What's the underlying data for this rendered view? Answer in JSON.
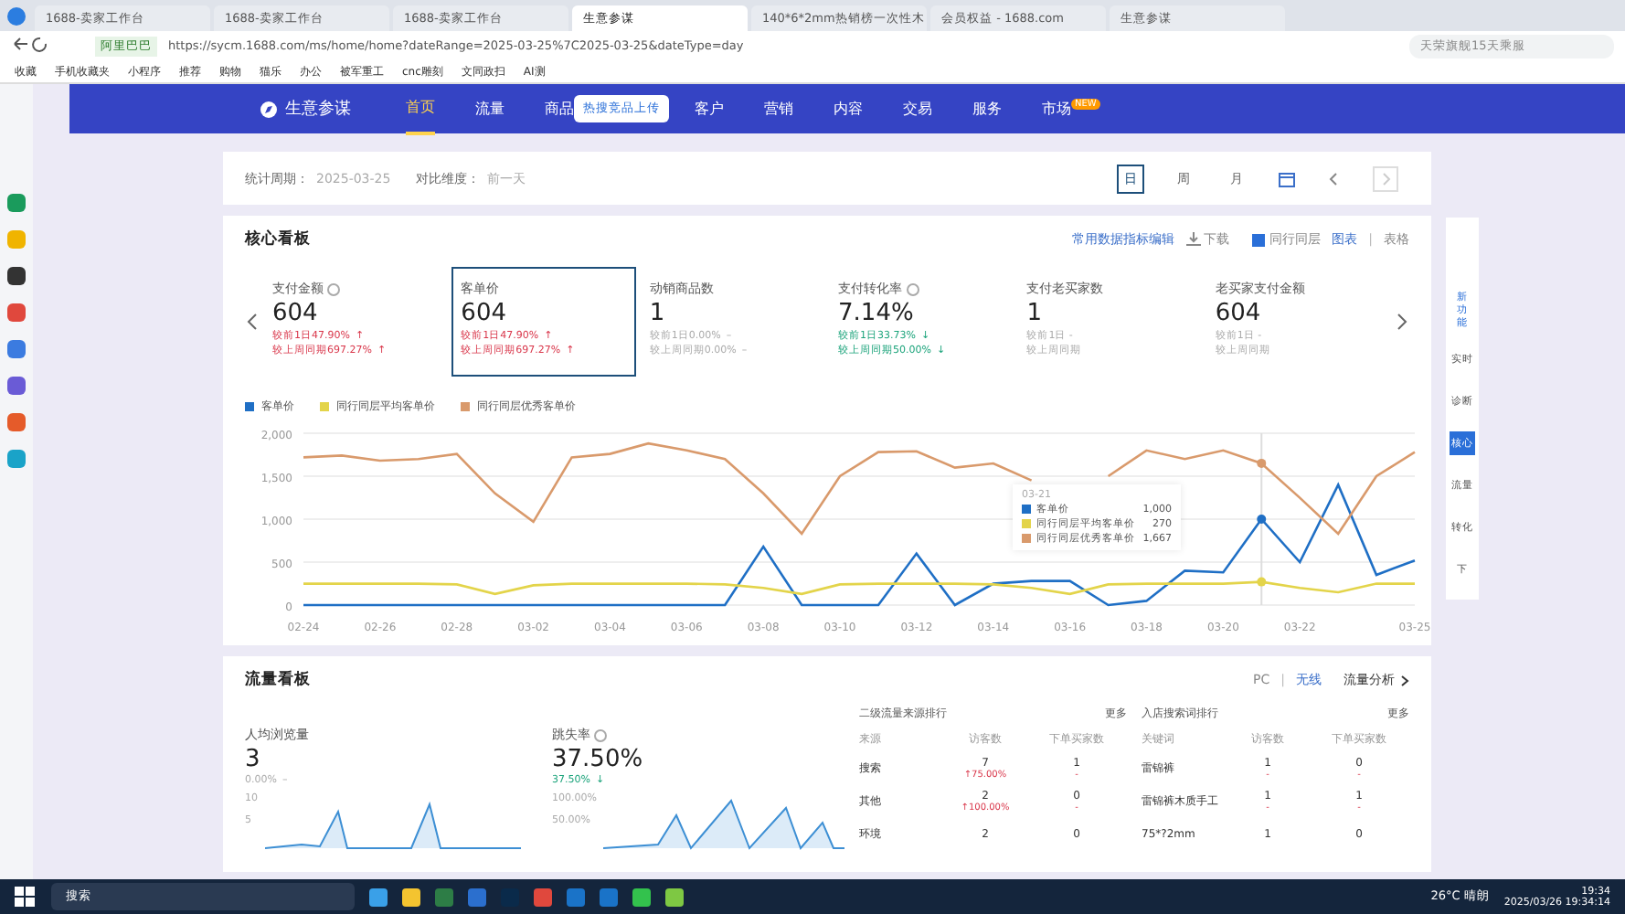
{
  "browser": {
    "tabs": [
      {
        "title": "1688-卖家工作台",
        "selected": false
      },
      {
        "title": "1688-卖家工作台",
        "selected": false
      },
      {
        "title": "1688-卖家工作台",
        "selected": false
      },
      {
        "title": "生意参谋",
        "selected": true
      },
      {
        "title": "140*6*2mm热销榜一次性木",
        "selected": false
      },
      {
        "title": "会员权益 - 1688.com",
        "selected": false
      },
      {
        "title": "生意参谋",
        "selected": false
      }
    ],
    "site_label": "阿里巴巴",
    "url": "https://sycm.1688.com/ms/home/home?dateRange=2025-03-25%7C2025-03-25&dateType=day",
    "search": "天荣旗舰15天乘服",
    "bookmarks": [
      "收藏",
      "手机收藏夹",
      "小程序",
      "推荐",
      "购物",
      "猫乐",
      "办公",
      "被军重工",
      "cnc雕刻",
      "文同政扫",
      "AI测"
    ]
  },
  "nav": {
    "logo": "生意参谋",
    "items": [
      {
        "label": "首页",
        "selected": true
      },
      {
        "label": "流量",
        "selected": false
      },
      {
        "label": "商品",
        "selected": false
      },
      {
        "label": "客户",
        "selected": false
      },
      {
        "label": "营销",
        "selected": false
      },
      {
        "label": "内容",
        "selected": false
      },
      {
        "label": "交易",
        "selected": false
      },
      {
        "label": "服务",
        "selected": false
      },
      {
        "label": "市场",
        "selected": false,
        "badge": "NEW"
      }
    ],
    "popup": "热搜竞品上传"
  },
  "period": {
    "label": "统计周期：",
    "value": "2025-03-25",
    "compare_label": "对比维度：",
    "compare_value": "前一天",
    "ranges": [
      {
        "label": "日",
        "selected": true
      },
      {
        "label": "周",
        "selected": false
      },
      {
        "label": "月",
        "selected": false
      }
    ]
  },
  "core": {
    "title": "核心看板",
    "edit_link": "常用数据指标编辑",
    "download": "下载",
    "peer_checkbox": {
      "label": "同行同层",
      "checked": true
    },
    "views": [
      {
        "label": "图表",
        "selected": true
      },
      {
        "label": "表格",
        "selected": false
      }
    ],
    "views_separator": "|",
    "metrics": [
      {
        "name": "支付金额",
        "info": true,
        "value": "604",
        "selected": false,
        "compare": [
          {
            "text": "较前1日47.90%",
            "arrow": "↑",
            "kind": "up"
          },
          {
            "text": "较上周同期697.27%",
            "arrow": "↑",
            "kind": "up"
          }
        ]
      },
      {
        "name": "客单价",
        "info": false,
        "value": "604",
        "selected": true,
        "compare": [
          {
            "text": "较前1日47.90%",
            "arrow": "↑",
            "kind": "up"
          },
          {
            "text": "较上周同期697.27%",
            "arrow": "↑",
            "kind": "up"
          }
        ]
      },
      {
        "name": "动销商品数",
        "info": false,
        "value": "1",
        "selected": false,
        "compare": [
          {
            "text": "较前1日0.00%",
            "arrow": "–",
            "kind": "flat"
          },
          {
            "text": "较上周同期0.00%",
            "arrow": "–",
            "kind": "flat"
          }
        ]
      },
      {
        "name": "支付转化率",
        "info": true,
        "value": "7.14%",
        "selected": false,
        "compare": [
          {
            "text": "较前1日33.73%",
            "arrow": "↓",
            "kind": "down"
          },
          {
            "text": "较上周同期50.00%",
            "arrow": "↓",
            "kind": "down"
          }
        ]
      },
      {
        "name": "支付老买家数",
        "info": false,
        "value": "1",
        "selected": false,
        "compare": [
          {
            "text": "较前1日 -",
            "kind": "flat"
          },
          {
            "text": "较上周同期",
            "kind": "flat"
          }
        ]
      },
      {
        "name": "老买家支付金额",
        "info": false,
        "value": "604",
        "selected": false,
        "compare": [
          {
            "text": "较前1日 -",
            "kind": "flat"
          },
          {
            "text": "较上周同期",
            "kind": "flat"
          }
        ]
      }
    ],
    "chart_data": {
      "type": "line",
      "grid": true,
      "legend": true,
      "categories": [
        "02-24",
        null,
        "02-26",
        null,
        "02-28",
        null,
        "03-02",
        null,
        "03-04",
        null,
        "03-06",
        null,
        "03-08",
        null,
        "03-10",
        null,
        "03-12",
        null,
        "03-14",
        null,
        "03-16",
        null,
        "03-18",
        null,
        "03-20",
        null,
        "03-22",
        null,
        null,
        "03-25"
      ],
      "ylim": [
        0,
        2000
      ],
      "yticks": [
        {
          "value": 0,
          "label": "0"
        },
        {
          "value": 500,
          "label": "500"
        },
        {
          "value": 1000,
          "label": "1,000"
        },
        {
          "value": 1500,
          "label": "1,500"
        },
        {
          "value": 2000,
          "label": "2,000"
        }
      ],
      "series": [
        {
          "name": "客单价",
          "color": "#1f6fc5",
          "values": [
            0,
            0,
            0,
            0,
            0,
            0,
            0,
            0,
            0,
            0,
            0,
            0,
            680,
            0,
            0,
            0,
            600,
            0,
            250,
            280,
            280,
            0,
            50,
            400,
            380,
            1000,
            500,
            1400,
            350,
            520
          ]
        },
        {
          "name": "同行同层平均客单价",
          "color": "#e3d44a",
          "values": [
            250,
            250,
            250,
            250,
            240,
            130,
            230,
            250,
            250,
            250,
            250,
            240,
            200,
            130,
            240,
            250,
            250,
            250,
            240,
            200,
            130,
            240,
            250,
            250,
            250,
            270,
            200,
            150,
            250,
            250
          ]
        },
        {
          "name": "同行同层优秀客单价",
          "color": "#d99a6c",
          "values": [
            1720,
            1740,
            1680,
            1700,
            1760,
            1300,
            970,
            1720,
            1760,
            1880,
            1800,
            1700,
            1300,
            830,
            1500,
            1780,
            1790,
            1600,
            1650,
            1450,
            null,
            1500,
            1800,
            1700,
            1800,
            1650,
            1250,
            830,
            1500,
            1780
          ]
        }
      ]
    },
    "tooltip": {
      "date": "03-21",
      "rows": [
        {
          "name": "客单价",
          "value": "1,000",
          "color": "#1f6fc5"
        },
        {
          "name": "同行同层平均客单价",
          "value": "270",
          "color": "#e3d44a"
        },
        {
          "name": "同行同层优秀客单价",
          "value": "1,667",
          "color": "#d99a6c"
        }
      ]
    }
  },
  "side_panel": {
    "items": [
      {
        "label": "实时",
        "selected": false
      },
      {
        "label": "诊断",
        "selected": false
      },
      {
        "label": "核心",
        "selected": true
      },
      {
        "label": "流量",
        "selected": false
      },
      {
        "label": "转化",
        "selected": false
      },
      {
        "label": "下",
        "selected": false
      }
    ],
    "new_feature": "新功能"
  },
  "flow": {
    "title": "流量看板",
    "device": [
      {
        "label": "PC",
        "selected": false
      },
      {
        "label": "无线",
        "selected": true
      }
    ],
    "device_separator": "|",
    "analysis_link": "流量分析",
    "stats": [
      {
        "name": "人均浏览量",
        "info": false,
        "value": "3",
        "compare": "0.00%",
        "arrow": "–",
        "kind": "flat",
        "ticks": [
          "10",
          "5"
        ]
      },
      {
        "name": "跳失率",
        "info": true,
        "value": "37.50%",
        "compare": "37.50%",
        "arrow": "↓",
        "kind": "down",
        "ticks": [
          "100.00%",
          "50.00%"
        ]
      }
    ],
    "tables": [
      {
        "title": "二级流量来源排行",
        "more": "更多",
        "columns": [
          "来源",
          "访客数",
          "下单买家数"
        ],
        "rows": [
          [
            {
              "value": "搜索"
            },
            {
              "value": "7",
              "change": "↑75.00%"
            },
            {
              "value": "1",
              "change": "-"
            }
          ],
          [
            {
              "value": "其他"
            },
            {
              "value": "2",
              "change": "↑100.00%"
            },
            {
              "value": "0",
              "change": "-"
            }
          ],
          [
            {
              "value": "环境"
            },
            {
              "value": "2"
            },
            {
              "value": "0"
            }
          ]
        ]
      },
      {
        "title": "入店搜索词排行",
        "more": "更多",
        "columns": [
          "关键词",
          "访客数",
          "下单买家数"
        ],
        "rows": [
          [
            {
              "value": "雷锦裤"
            },
            {
              "value": "1",
              "change": "-"
            },
            {
              "value": "0",
              "change": "-"
            }
          ],
          [
            {
              "value": "雷锦裤木质手工"
            },
            {
              "value": "1",
              "change": "-"
            },
            {
              "value": "1",
              "change": "-"
            }
          ],
          [
            {
              "value": "75*?2mm"
            },
            {
              "value": "1"
            },
            {
              "value": "0"
            }
          ]
        ]
      }
    ]
  },
  "taskbar": {
    "search": "搜索",
    "weather": "26°C 晴朗",
    "time": "19:34",
    "date": "2025/03/26 19:34:14"
  }
}
